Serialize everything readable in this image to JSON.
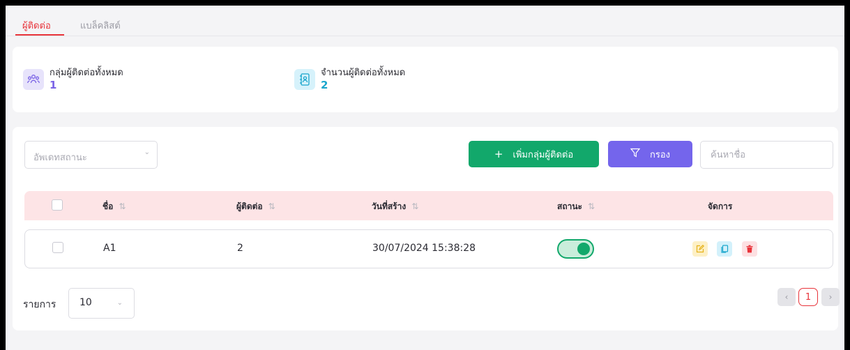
{
  "tabs": {
    "contacts": "ผู้ติดต่อ",
    "blacklist": "แบล็คลิสต์"
  },
  "stats": {
    "groups_label": "กลุ่มผู้ติดต่อทั้งหมด",
    "groups_value": "1",
    "contacts_label": "จำนวนผู้ติดต่อทั้งหมด",
    "contacts_value": "2"
  },
  "toolbar": {
    "status_placeholder": "อัพเดทสถานะ",
    "add_group_label": "เพิ่มกลุ่มผู้ติดต่อ",
    "filter_label": "กรอง",
    "search_placeholder": "ค้นหาชื่อ"
  },
  "table": {
    "headers": {
      "name": "ชื่อ",
      "contacts": "ผู้ติดต่อ",
      "created": "วันที่สร้าง",
      "status": "สถานะ",
      "actions": "จัดการ"
    },
    "rows": [
      {
        "name": "A1",
        "contacts": "2",
        "created": "30/07/2024 15:38:28",
        "status_on": true
      }
    ]
  },
  "footer": {
    "per_page_label": "รายการ",
    "per_page_value": "10",
    "current_page": "1"
  },
  "colors": {
    "accent_red": "#e8333a",
    "green": "#12a86b",
    "purple": "#7465ec",
    "cyan": "#1aa6cc",
    "header_bg": "#fde4e6"
  },
  "icons": {
    "groups": "users-group-icon",
    "contacts": "address-book-icon",
    "add": "plus-icon",
    "filter": "filter-funnel-icon",
    "edit": "edit-icon",
    "copy": "copy-icon",
    "delete": "trash-icon"
  }
}
